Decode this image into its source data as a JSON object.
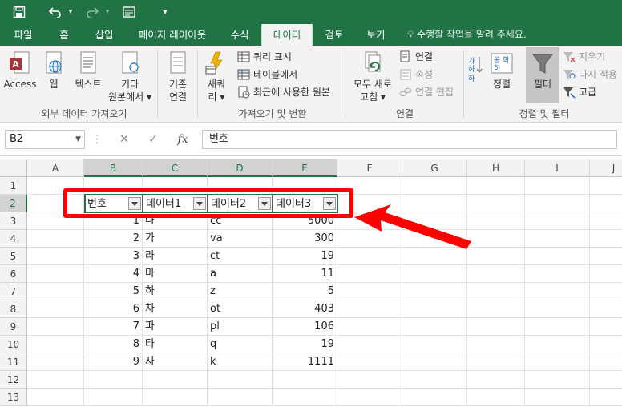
{
  "titlebar": {
    "save_icon": "save-icon",
    "undo_icon": "undo-icon",
    "redo_icon": "redo-icon",
    "form_icon": "form-icon",
    "customize_icon": "customize-qat-icon"
  },
  "tabs": [
    "파일",
    "홈",
    "삽입",
    "페이지 레이아웃",
    "수식",
    "데이터",
    "검토",
    "보기"
  ],
  "active_tab": "데이터",
  "tellme": "수행할 작업을 알려 주세요.",
  "ribbon": {
    "external": {
      "access": "Access",
      "web": "웹",
      "text": "텍스트",
      "other_line1": "기타",
      "other_line2": "원본에서 ▾",
      "group": "외부 데이터 가져오기"
    },
    "existing": {
      "line1": "기존",
      "line2": "연결"
    },
    "gettransform": {
      "new_line1": "새쿼",
      "new_line2": "리 ▾",
      "show_queries": "쿼리 표시",
      "from_table": "테이블에서",
      "recent_sources": "최근에 사용한 원본",
      "group": "가져오기 및 변환"
    },
    "connections": {
      "refresh_line1": "모두 새로",
      "refresh_line2": "고침 ▾",
      "connections": "연결",
      "properties": "속성",
      "edit_links": "연결 편집",
      "group": "연결"
    },
    "sortfilter": {
      "sort": "정렬",
      "filter": "필터",
      "clear": "지우기",
      "reapply": "다시 적용",
      "advanced": "고급",
      "group": "정렬 및 필터"
    }
  },
  "formula_bar": {
    "name_box": "B2",
    "cancel_icon": "✕",
    "enter_icon": "✓",
    "fx_label": "fx",
    "formula": "번호"
  },
  "sheet": {
    "columns": [
      "A",
      "B",
      "C",
      "D",
      "E",
      "F",
      "G",
      "H",
      "I",
      "J"
    ],
    "rows": [
      "1",
      "2",
      "3",
      "4",
      "5",
      "6",
      "7",
      "8",
      "9",
      "10",
      "11",
      "12",
      "13"
    ],
    "headers": [
      "번호",
      "데이터1",
      "데이터2",
      "데이터3"
    ],
    "data": [
      [
        "1",
        "나",
        "cc",
        "5000"
      ],
      [
        "2",
        "가",
        "va",
        "300"
      ],
      [
        "3",
        "라",
        "ct",
        "19"
      ],
      [
        "4",
        "마",
        "a",
        "11"
      ],
      [
        "5",
        "하",
        "z",
        "5"
      ],
      [
        "6",
        "차",
        "ot",
        "403"
      ],
      [
        "7",
        "파",
        "pl",
        "106"
      ],
      [
        "8",
        "타",
        "q",
        "19"
      ],
      [
        "9",
        "사",
        "k",
        "1111"
      ]
    ]
  },
  "colors": {
    "excel_green": "#217346",
    "annotation_red": "#ff0000"
  }
}
